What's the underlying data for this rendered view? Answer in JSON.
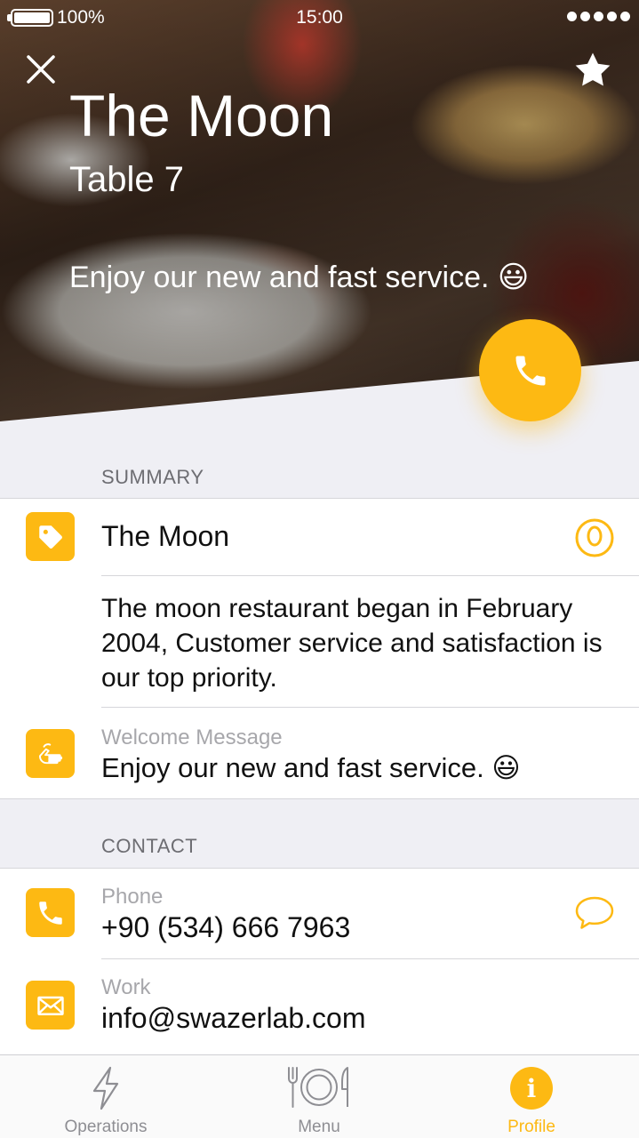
{
  "status_bar": {
    "battery": "100%",
    "time": "15:00"
  },
  "hero": {
    "title": "The Moon",
    "subtitle": "Table 7",
    "message": "Enjoy our new and fast service. 😃"
  },
  "summary": {
    "header": "SUMMARY",
    "name": "The Moon",
    "description": "The moon restaurant began in February 2004, Customer service and satisfaction is our top priority.",
    "welcome_label": "Welcome Message",
    "welcome_value": "Enjoy our new and fast service. 😃"
  },
  "contact": {
    "header": "CONTACT",
    "phone_label": "Phone",
    "phone_value": "+90 (534) 666 7963",
    "email_label": "Work",
    "email_value": "info@swazerlab.com"
  },
  "tabs": [
    {
      "label": "Operations",
      "icon": "lightning-icon"
    },
    {
      "label": "Menu",
      "icon": "plate-cutlery-icon"
    },
    {
      "label": "Profile",
      "icon": "info-icon",
      "active": true
    }
  ],
  "colors": {
    "accent": "#fdb913",
    "background": "#efeff4",
    "text": "#111111",
    "secondary": "#a7a7ab"
  }
}
